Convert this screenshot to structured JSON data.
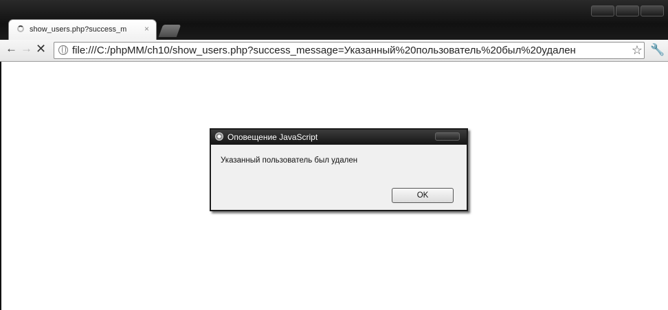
{
  "browser": {
    "tab": {
      "title": "show_users.php?success_m",
      "close_glyph": "×"
    },
    "nav": {
      "back_glyph": "←",
      "forward_glyph": "→",
      "stop_glyph": "✕"
    },
    "address_bar": {
      "url": "file:///C:/phpMM/ch10/show_users.php?success_message=Указанный%20пользователь%20был%20удален",
      "star_glyph": "☆"
    },
    "wrench_glyph": "🔧"
  },
  "dialog": {
    "title": "Оповещение JavaScript",
    "message": "Указанный пользователь был удален",
    "ok_label": "OK"
  },
  "icons": [
    "loading-spinner-icon",
    "back-arrow-icon",
    "forward-arrow-icon",
    "stop-icon",
    "globe-icon",
    "star-icon",
    "wrench-icon",
    "chrome-logo-icon"
  ],
  "colors": {
    "titlebar": "#151515",
    "dialog_bg": "#f0f0f0",
    "page_bg": "#ffffff"
  }
}
